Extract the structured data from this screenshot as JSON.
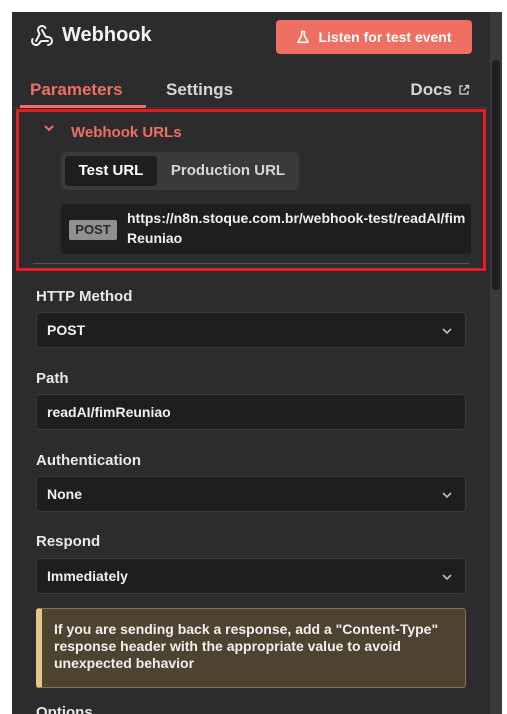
{
  "header": {
    "title": "Webhook",
    "node_icon": "webhook-icon",
    "listen_button": "Listen for test event",
    "listen_icon": "flask-icon"
  },
  "tabs": {
    "parameters": "Parameters",
    "settings": "Settings",
    "docs": "Docs",
    "active": "Parameters"
  },
  "webhook_urls": {
    "title": "Webhook URLs",
    "toggle": [
      "Test URL",
      "Production URL"
    ],
    "selected": "Test URL",
    "method": "POST",
    "url": "https://n8n.stoque.com.br/webhook-test/readAI/fimReuniao"
  },
  "fields": {
    "http_method": {
      "label": "HTTP Method",
      "value": "POST"
    },
    "path": {
      "label": "Path",
      "value": "readAI/fimReuniao"
    },
    "authentication": {
      "label": "Authentication",
      "value": "None"
    },
    "respond": {
      "label": "Respond",
      "value": "Immediately"
    }
  },
  "notice": "If you are sending back a response, add a \"Content-Type\" response header with the appropriate value to avoid unexpected behavior",
  "options_label": "Options",
  "colors": {
    "accent": "#ef6f63",
    "highlight_border": "#e51c23",
    "panel_bg": "#2c2c2e",
    "input_bg": "#1e1e20",
    "notice_bg": "#4e4331",
    "notice_border": "#e8c48a"
  }
}
